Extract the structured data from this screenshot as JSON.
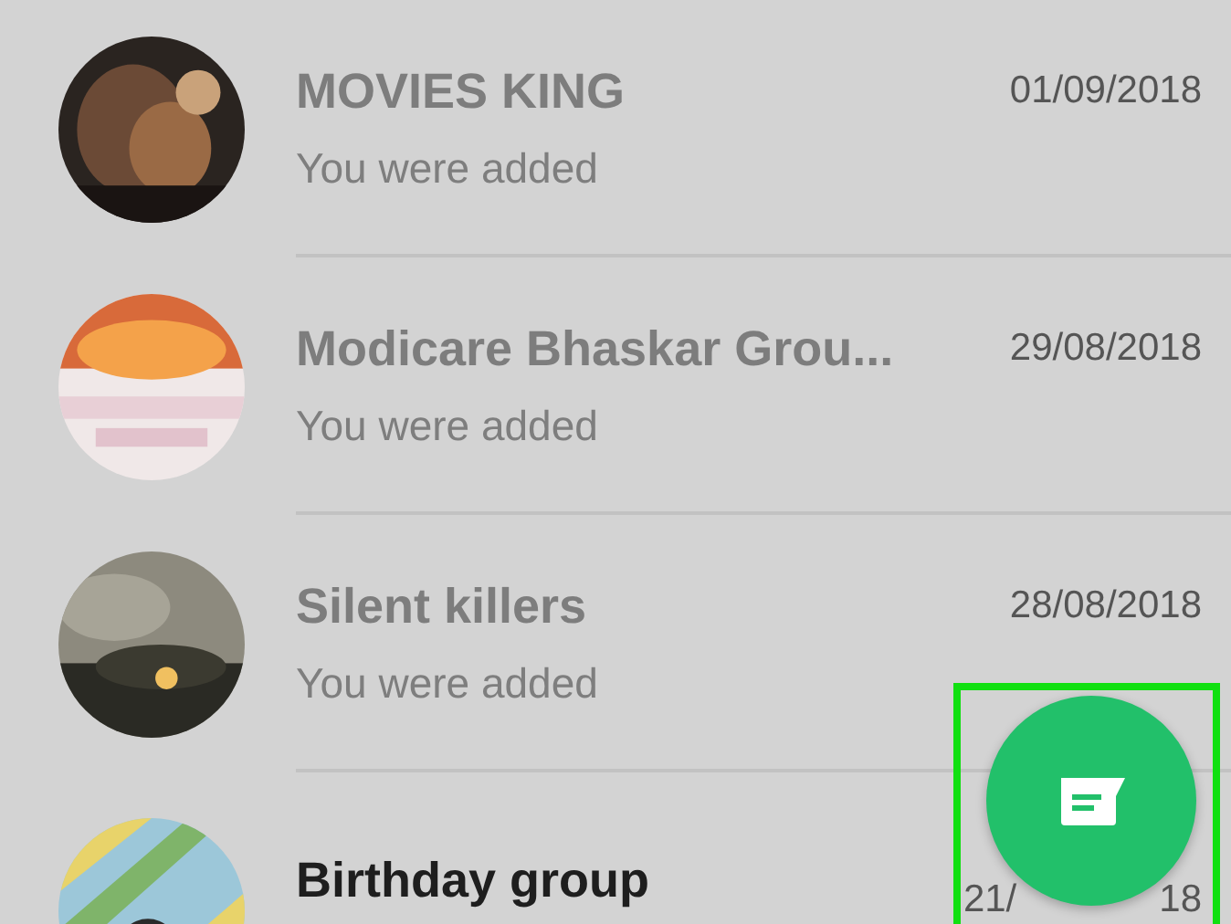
{
  "chats": [
    {
      "name": "MOVIES KING",
      "date": [
        "01/09/2018"
      ],
      "preview": "You were added"
    },
    {
      "name": "Modicare  Bhaskar Grou...",
      "date": [
        "29/08/2018"
      ],
      "preview": "You were added"
    },
    {
      "name": "Silent killers",
      "date": [
        "28/08/2018"
      ],
      "preview": "You were added"
    },
    {
      "name": "Birthday group",
      "date": [
        "21/",
        "18"
      ]
    }
  ],
  "new_chat_button": {
    "highlighted": true
  }
}
